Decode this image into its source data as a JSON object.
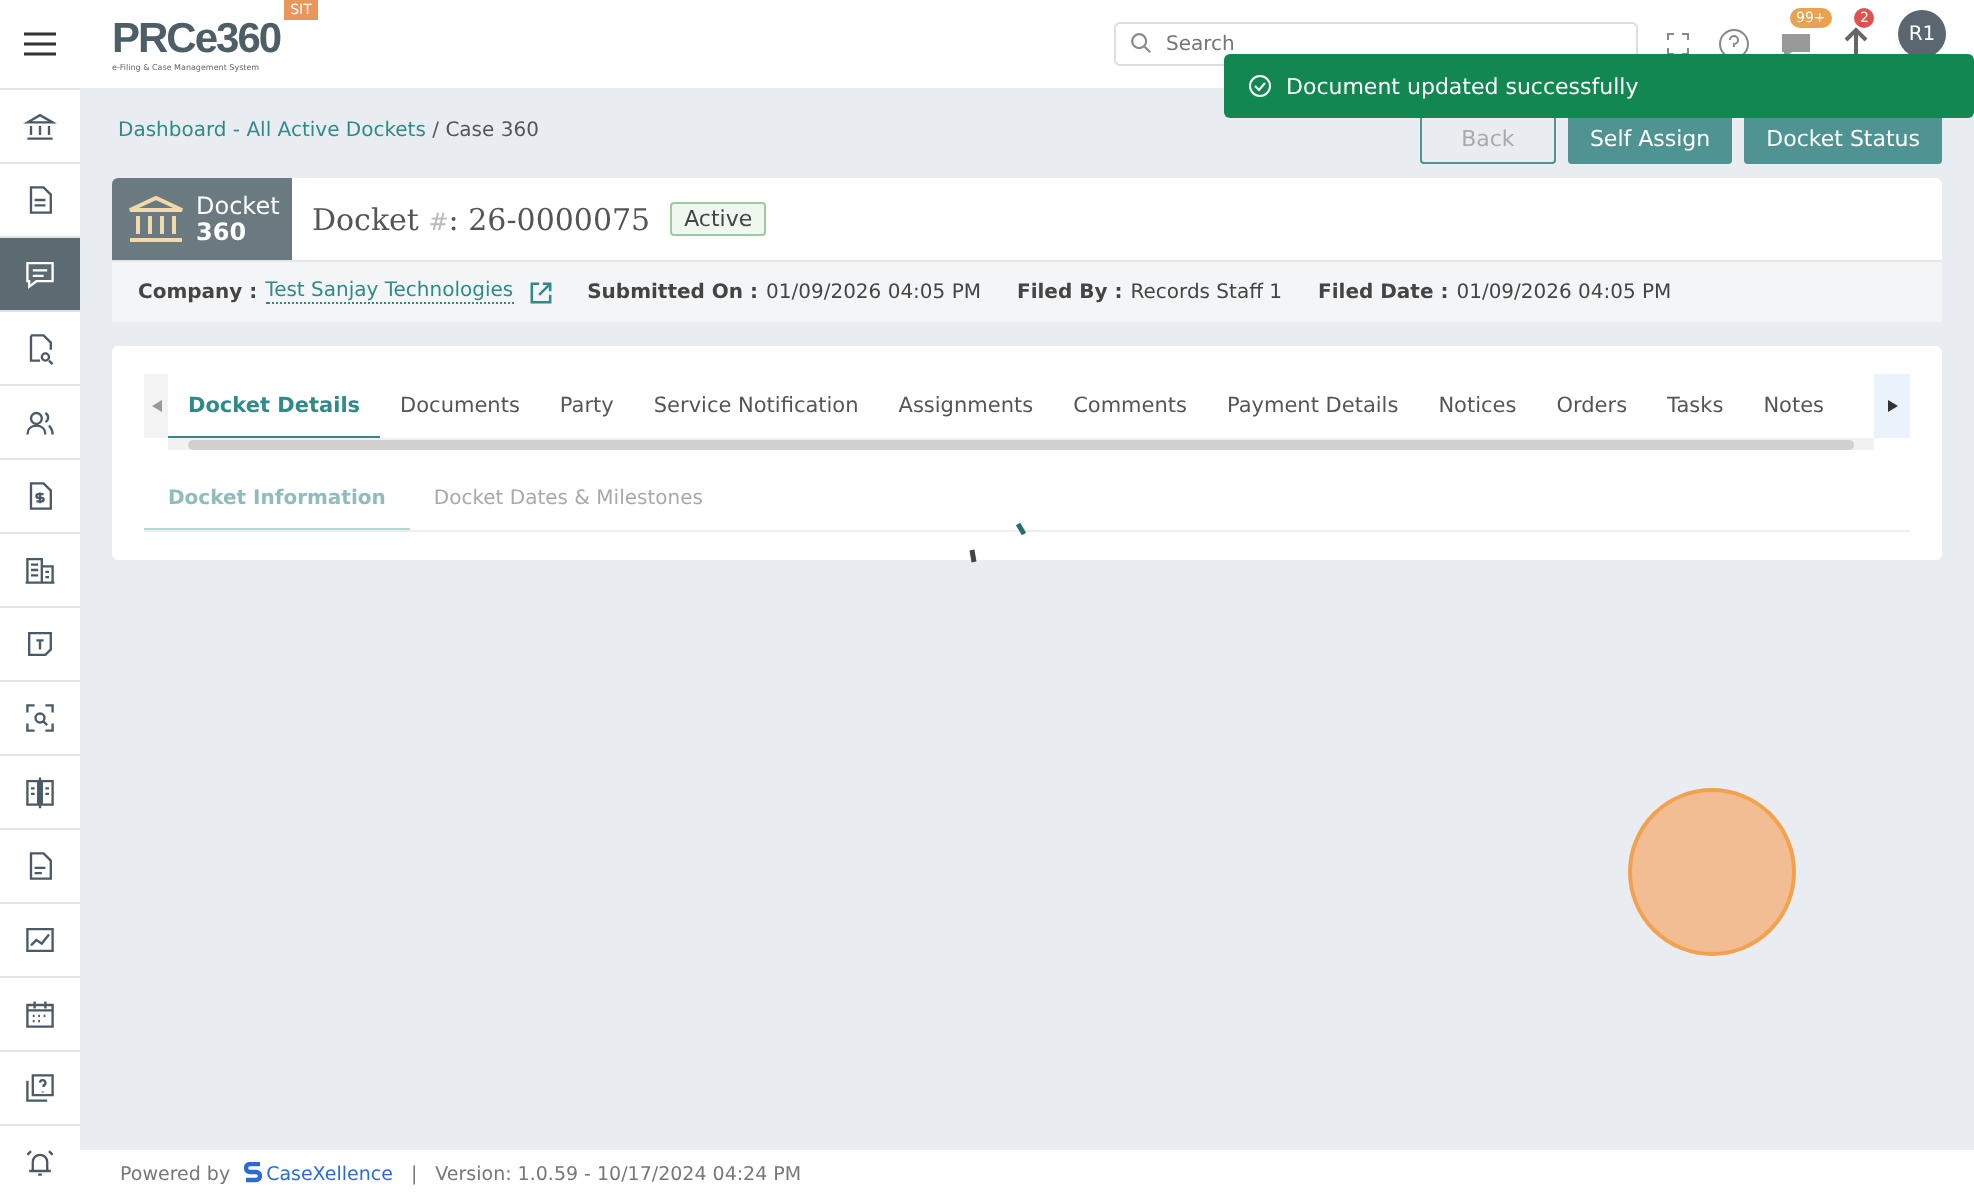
{
  "header": {
    "logo": "PRCe360",
    "tagline": "e-Filing & Case Management System",
    "env_badge": "SIT",
    "search": {
      "placeholder": "Search"
    },
    "messages_badge": "99+",
    "notifications_badge": "2",
    "avatar": "R1"
  },
  "sidebar": {
    "items": [
      {
        "selected": false
      },
      {
        "selected": false
      },
      {
        "selected": true
      },
      {
        "selected": false
      },
      {
        "selected": false
      },
      {
        "selected": false
      },
      {
        "selected": false
      },
      {
        "selected": false
      },
      {
        "selected": false
      },
      {
        "selected": false
      },
      {
        "selected": false
      },
      {
        "selected": false
      },
      {
        "selected": false
      },
      {
        "selected": false
      },
      {
        "selected": false
      }
    ]
  },
  "toast": {
    "message": "Document updated successfully"
  },
  "breadcrumb": {
    "link": "Dashboard - All Active Dockets",
    "current": "/ Case 360"
  },
  "actions": [
    {
      "label": "Back",
      "kind": "outline"
    },
    {
      "label": "Self Assign",
      "kind": "filled"
    },
    {
      "label": "Docket Status",
      "kind": "filled"
    }
  ],
  "docket": {
    "badge_label": "Docket",
    "badge_number": "360",
    "title": "Docket",
    "hash": "#",
    "number": ": 26-0000075",
    "status": "Active",
    "fields": [
      {
        "label": "Company :",
        "value": "Test Sanjay Technologies",
        "kind": "link"
      },
      {
        "label": "Submitted On :",
        "value": "01/09/2026 04:05 PM",
        "kind": "text"
      },
      {
        "label": "Filed By :",
        "value": "Records Staff 1",
        "kind": "text"
      },
      {
        "label": "Filed Date :",
        "value": "01/09/2026 04:05 PM",
        "kind": "text"
      }
    ]
  },
  "tabs": [
    {
      "label": "Docket Details",
      "selected": true
    },
    {
      "label": "Documents",
      "selected": false
    },
    {
      "label": "Party",
      "selected": false
    },
    {
      "label": "Service Notification",
      "selected": false
    },
    {
      "label": "Assignments",
      "selected": false
    },
    {
      "label": "Comments",
      "selected": false
    },
    {
      "label": "Payment Details",
      "selected": false
    },
    {
      "label": "Notices",
      "selected": false
    },
    {
      "label": "Orders",
      "selected": false
    },
    {
      "label": "Tasks",
      "selected": false
    },
    {
      "label": "Notes",
      "selected": false
    }
  ],
  "subtabs": [
    {
      "label": "Docket Information",
      "selected": true
    },
    {
      "label": "Docket Dates & Milestones",
      "selected": false
    }
  ],
  "footer": {
    "powered_by": "Powered by",
    "brand": "CaseXellence",
    "separator": "|",
    "version": "Version: 1.0.59 - 10/17/2024 04:24 PM"
  }
}
